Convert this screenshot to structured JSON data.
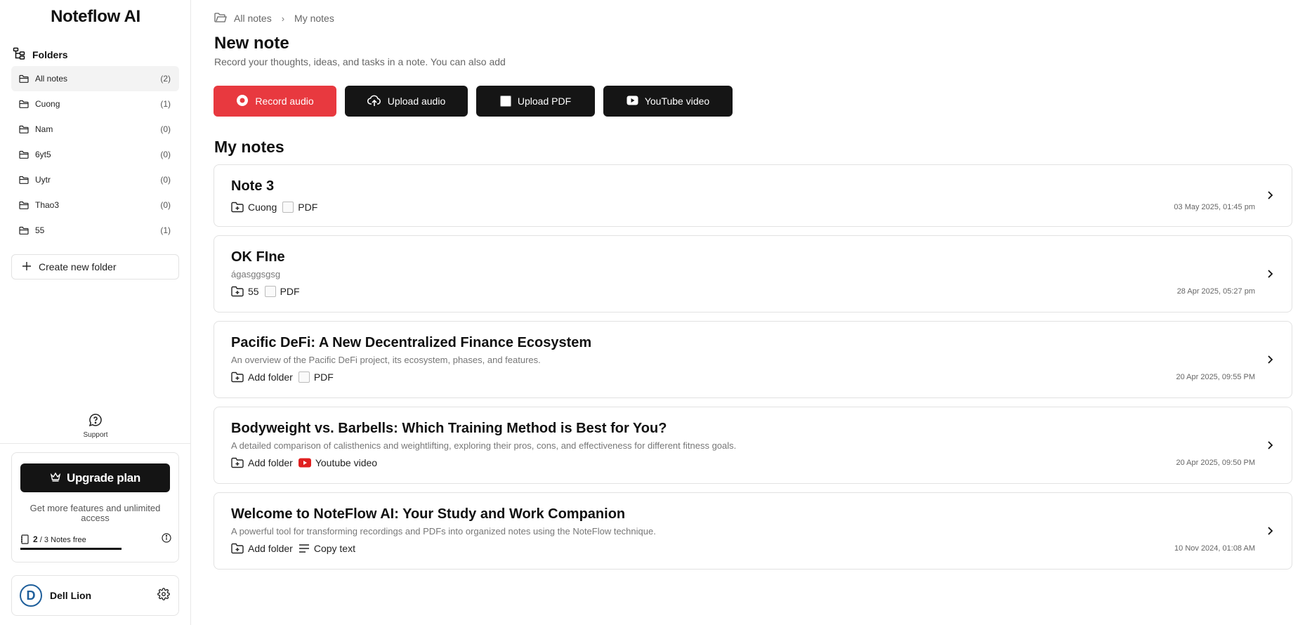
{
  "app": {
    "title": "Noteflow AI"
  },
  "sidebar": {
    "folders_heading": "Folders",
    "folders": [
      {
        "name": "All notes",
        "count": "(2)",
        "active": true
      },
      {
        "name": "Cuong",
        "count": "(1)"
      },
      {
        "name": "Nam",
        "count": "(0)"
      },
      {
        "name": "6yt5",
        "count": "(0)"
      },
      {
        "name": "Uytr",
        "count": "(0)"
      },
      {
        "name": "Thao3",
        "count": "(0)"
      },
      {
        "name": "55",
        "count": "(1)"
      }
    ],
    "create_folder_label": "Create new folder",
    "support_label": "Support",
    "upgrade": {
      "button_label": "Upgrade plan",
      "description": "Get more features and unlimited access",
      "used": "2",
      "quota_text": "/ 3 Notes free",
      "progress_fraction": 0.67
    },
    "user": {
      "initial": "D",
      "name": "Dell Lion"
    }
  },
  "breadcrumb": {
    "root": "All notes",
    "current": "My notes"
  },
  "header": {
    "title": "New note",
    "subtitle": "Record your thoughts, ideas, and tasks in a note. You can also add"
  },
  "actions": {
    "record_audio": "Record audio",
    "upload_audio": "Upload audio",
    "upload_pdf": "Upload PDF",
    "youtube_video": "YouTube video"
  },
  "notes_section": {
    "title": "My notes",
    "notes": [
      {
        "title": "Note 3",
        "description": "",
        "folder": "Cuong",
        "source": "PDF",
        "date": "03 May 2025, 01:45 pm"
      },
      {
        "title": "OK FIne",
        "description": "ágasggsgsg",
        "folder": "55",
        "source": "PDF",
        "date": "28 Apr 2025, 05:27 pm"
      },
      {
        "title": "Pacific DeFi: A New Decentralized Finance Ecosystem",
        "description": "An overview of the Pacific DeFi project, its ecosystem, phases, and features.",
        "folder": "Add folder",
        "source": "PDF",
        "date": "20 Apr 2025, 09:55 PM"
      },
      {
        "title": "Bodyweight vs. Barbells: Which Training Method is Best for You?",
        "description": "A detailed comparison of calisthenics and weightlifting, exploring their pros, cons, and effectiveness for different fitness goals.",
        "folder": "Add folder",
        "source": "Youtube video",
        "date": "20 Apr 2025, 09:50 PM"
      },
      {
        "title": "Welcome to NoteFlow AI: Your Study and Work Companion",
        "description": "A powerful tool for transforming recordings and PDFs into organized notes using the NoteFlow technique.",
        "folder": "Add folder",
        "source": "Copy text",
        "date": "10 Nov 2024, 01:08 AM"
      }
    ]
  },
  "colors": {
    "accent_red": "#e8393f",
    "dark_button": "#151515",
    "youtube_red": "#e02020",
    "avatar_blue": "#1f5f9b"
  },
  "icons": [
    "folder-tree-icon",
    "folder-icon",
    "plus-icon",
    "support-icon",
    "crown-icon",
    "notebook-icon",
    "info-icon",
    "gear-icon",
    "record-icon",
    "upload-cloud-icon",
    "image-placeholder-icon",
    "youtube-icon",
    "folder-plus-icon",
    "text-lines-icon",
    "chevron-right-icon"
  ]
}
